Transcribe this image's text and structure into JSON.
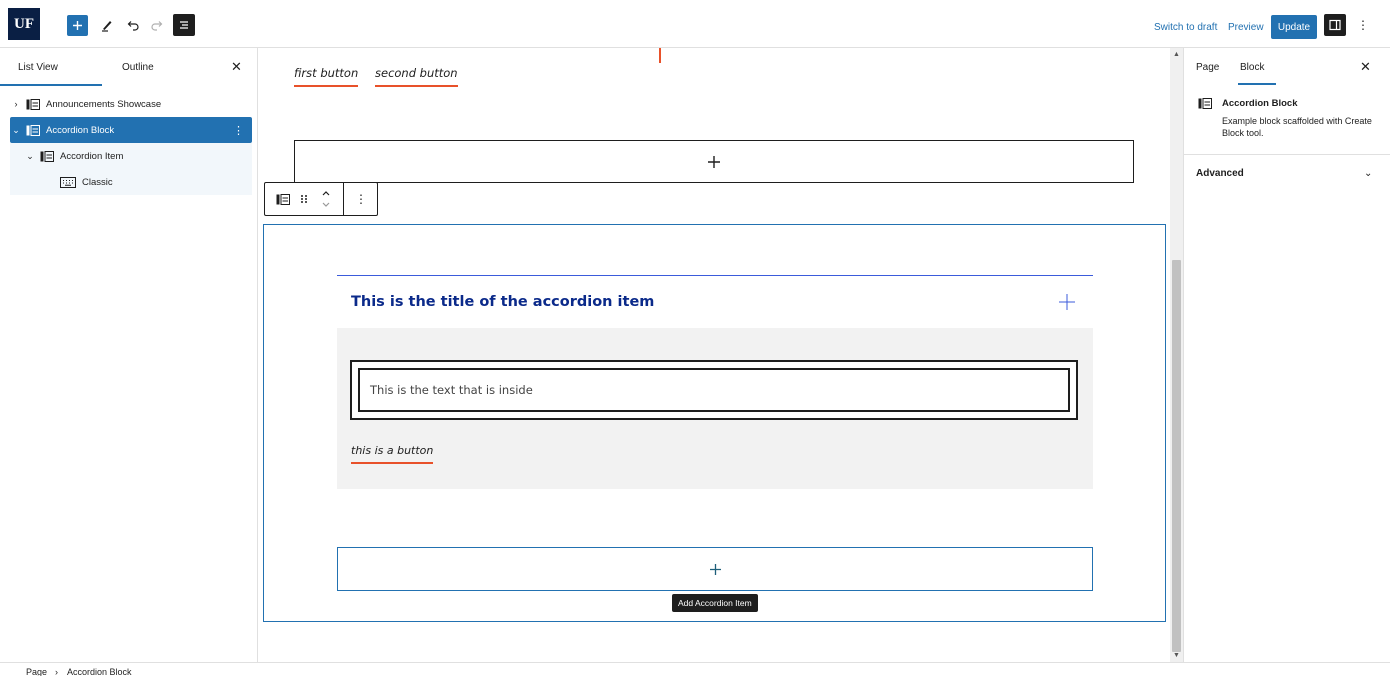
{
  "topbar": {
    "logo_text": "UF",
    "switch_to_draft": "Switch to draft",
    "preview": "Preview",
    "update": "Update",
    "more_glyph": "⋮",
    "accent_color": "#2271b1"
  },
  "left_panel": {
    "tabs": [
      "List View",
      "Outline"
    ],
    "close_glyph": "✕",
    "items": [
      {
        "label": "Announcements Showcase",
        "chevron": "›",
        "icon": "block-icon"
      },
      {
        "label": "Accordion Block",
        "chevron": "⌄",
        "icon": "block-icon",
        "options": "⋮"
      },
      {
        "label": "Accordion Item",
        "chevron": "⌄",
        "icon": "block-icon"
      },
      {
        "label": "Classic",
        "icon": "keyboard-icon"
      }
    ]
  },
  "canvas": {
    "buttons": [
      "first button",
      "second button"
    ],
    "appender_glyph": "+",
    "toolbar_more": "⋮",
    "accordion": {
      "title": "This is the title of the accordion item",
      "body_text": "This is the text that is inside",
      "button": "this is a button"
    },
    "add_item_glyph": "+",
    "tooltip": "Add Accordion Item"
  },
  "right_panel": {
    "tabs": [
      "Page",
      "Block"
    ],
    "close_glyph": "✕",
    "block_name": "Accordion Block",
    "block_description": "Example block scaffolded with Create Block tool.",
    "advanced": "Advanced",
    "advanced_chevron": "⌄"
  },
  "footer": {
    "crumbs": [
      "Page",
      "Accordion Block"
    ],
    "separator": "›"
  }
}
